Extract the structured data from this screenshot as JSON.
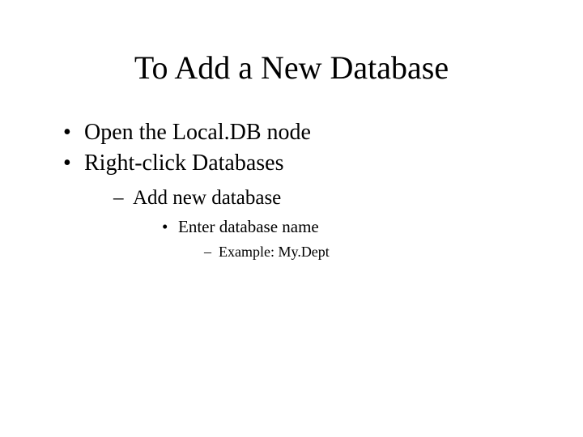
{
  "title": "To Add a New Database",
  "bullets": {
    "level1": [
      "Open the Local.DB node",
      "Right-click Databases"
    ],
    "level2": [
      "Add new database"
    ],
    "level3": [
      "Enter database name"
    ],
    "level4": [
      "Example: My.Dept"
    ]
  }
}
